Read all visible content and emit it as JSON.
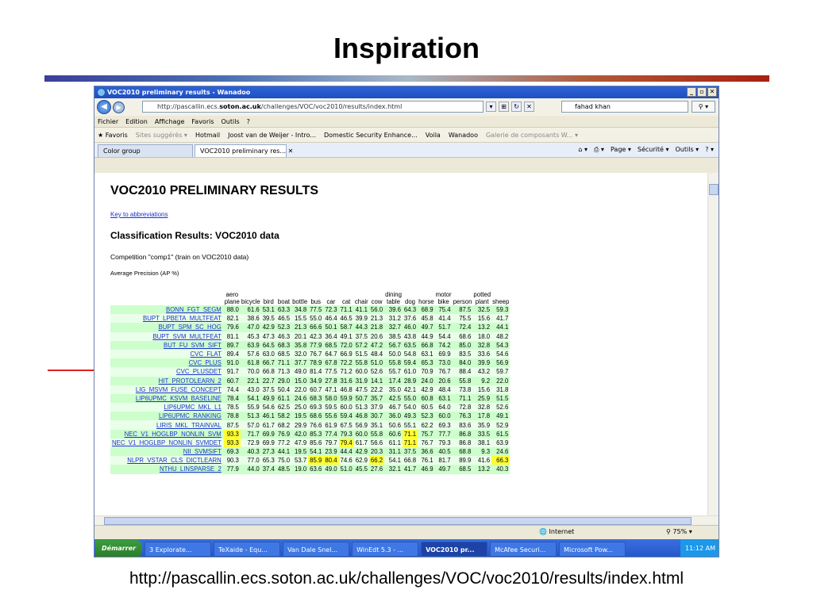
{
  "slide": {
    "title": "Inspiration",
    "caption": "http://pascallin.ecs.soton.ac.uk/challenges/VOC/voc2010/results/index.html"
  },
  "browser": {
    "window_title": "VOC2010 preliminary results - Wanadoo",
    "url_prefix": "http://pascallin.ecs.",
    "url_bold": "soton.ac.uk",
    "url_suffix": "/challenges/VOC/voc2010/results/index.html",
    "search_value": "fahad khan",
    "menu": [
      "Fichier",
      "Edition",
      "Affichage",
      "Favoris",
      "Outils",
      "?"
    ],
    "favorites": {
      "label": "Favoris",
      "items": [
        "Sites suggérés ▾",
        "Hotmail",
        "Joost van de Weijer - Intro...",
        "Domestic Security Enhance...",
        "Voila",
        "Wanadoo",
        "Galerie de composants W... ▾"
      ]
    },
    "tabs": [
      "Color group",
      "VOC2010 preliminary res..."
    ],
    "tab_tools": [
      "Page ▾",
      "Sécurité ▾",
      "Outils ▾"
    ],
    "status_zone": "Internet",
    "zoom": "75%",
    "taskbar": {
      "start": "Démarrer",
      "tasks": [
        "3 Explorate...",
        "TeXaide - Equ...",
        "Van Dale Snel...",
        "WinEdt 5.3 - ...",
        "VOC2010 pr...",
        "McAfee Securi...",
        "Microsoft Pow..."
      ],
      "clock": "11:12 AM"
    }
  },
  "page": {
    "heading": "VOC2010 PRELIMINARY RESULTS",
    "key_link": "Key to abbreviations",
    "subheading": "Classification Results: VOC2010 data",
    "competition": "Competition \"comp1\" (train on VOC2010 data)",
    "metric": "Average Precision (AP %)",
    "columns": [
      [
        "aero",
        "plane"
      ],
      [
        "",
        "bicycle"
      ],
      [
        "",
        "bird"
      ],
      [
        "",
        "boat"
      ],
      [
        "",
        "bottle"
      ],
      [
        "",
        "bus"
      ],
      [
        "",
        "car"
      ],
      [
        "",
        "cat"
      ],
      [
        "",
        "chair"
      ],
      [
        "",
        "cow"
      ],
      [
        "dining",
        "table"
      ],
      [
        "",
        "dog"
      ],
      [
        "",
        "horse"
      ],
      [
        "motor",
        "bike"
      ],
      [
        "",
        "person"
      ],
      [
        "potted",
        "plant"
      ],
      [
        "",
        "sheep"
      ]
    ],
    "rows": [
      {
        "method": "BONN_FGT_SEGM",
        "values": [
          "88.0",
          "61.6",
          "53.1",
          "63.3",
          "34.8",
          "77.5",
          "72.3",
          "71.1",
          "41.1",
          "56.0",
          "39.6",
          "64.3",
          "68.9",
          "75.4",
          "87.5",
          "32.5",
          "59.3"
        ],
        "hl": []
      },
      {
        "method": "BUPT_LPBETA_MULTFEAT",
        "values": [
          "82.1",
          "38.6",
          "39.5",
          "46.5",
          "15.5",
          "55.0",
          "46.4",
          "46.5",
          "39.9",
          "21.3",
          "31.2",
          "37.6",
          "45.8",
          "41.4",
          "75.5",
          "15.6",
          "41.7"
        ],
        "hl": []
      },
      {
        "method": "BUPT_SPM_SC_HOG",
        "values": [
          "79.6",
          "47.0",
          "42.9",
          "52.3",
          "21.3",
          "66.6",
          "50.1",
          "58.7",
          "44.3",
          "21.8",
          "32.7",
          "46.0",
          "49.7",
          "51.7",
          "72.4",
          "13.2",
          "44.1"
        ],
        "hl": []
      },
      {
        "method": "BUPT_SVM_MULTFEAT",
        "values": [
          "81.1",
          "45.3",
          "47.3",
          "46.3",
          "20.1",
          "42.3",
          "36.4",
          "49.1",
          "37.5",
          "20.6",
          "38.5",
          "43.8",
          "44.9",
          "54.4",
          "68.6",
          "18.0",
          "48.2"
        ],
        "hl": []
      },
      {
        "method": "BUT_FU_SVM_SIFT",
        "values": [
          "89.7",
          "63.9",
          "64.5",
          "68.3",
          "35.8",
          "77.9",
          "68.5",
          "72.0",
          "57.2",
          "47.2",
          "56.7",
          "63.5",
          "66.8",
          "74.2",
          "85.0",
          "32.8",
          "54.3"
        ],
        "hl": []
      },
      {
        "method": "CVC_FLAT",
        "values": [
          "89.4",
          "57.6",
          "63.0",
          "68.5",
          "32.0",
          "76.7",
          "64.7",
          "66.9",
          "51.5",
          "48.4",
          "50.0",
          "54.8",
          "63.1",
          "69.9",
          "83.5",
          "33.6",
          "54.6"
        ],
        "hl": []
      },
      {
        "method": "CVC_PLUS",
        "values": [
          "91.0",
          "61.8",
          "66.7",
          "71.1",
          "37.7",
          "78.9",
          "67.8",
          "72.2",
          "55.8",
          "51.0",
          "55.8",
          "59.4",
          "65.3",
          "73.0",
          "84.0",
          "39.9",
          "56.9"
        ],
        "hl": []
      },
      {
        "method": "CVC_PLUSDET",
        "values": [
          "91.7",
          "70.0",
          "66.8",
          "71.3",
          "49.0",
          "81.4",
          "77.5",
          "71.2",
          "60.0",
          "52.6",
          "55.7",
          "61.0",
          "70.9",
          "76.7",
          "88.4",
          "43.2",
          "59.7"
        ],
        "hl": []
      },
      {
        "method": "HIT_PROTOLEARN_2",
        "values": [
          "60.7",
          "22.1",
          "22.7",
          "29.0",
          "15.0",
          "34.9",
          "27.8",
          "31.6",
          "31.9",
          "14.1",
          "17.4",
          "28.9",
          "24.0",
          "20.6",
          "55.8",
          "9.2",
          "22.0"
        ],
        "hl": []
      },
      {
        "method": "LIG_MSVM_FUSE_CONCEPT",
        "values": [
          "74.4",
          "43.0",
          "37.5",
          "50.4",
          "22.0",
          "60.7",
          "47.1",
          "46.8",
          "47.5",
          "22.2",
          "35.0",
          "42.1",
          "42.9",
          "48.4",
          "73.8",
          "15.6",
          "31.8"
        ],
        "hl": []
      },
      {
        "method": "LIP6UPMC_KSVM_BASELINE",
        "values": [
          "78.4",
          "54.1",
          "49.9",
          "61.1",
          "24.6",
          "68.3",
          "58.0",
          "59.9",
          "50.7",
          "35.7",
          "42.5",
          "55.0",
          "60.8",
          "63.1",
          "71.1",
          "25.9",
          "51.5"
        ],
        "hl": []
      },
      {
        "method": "LIP6UPMC_MKL_L1",
        "values": [
          "78.5",
          "55.9",
          "54.6",
          "62.5",
          "25.0",
          "69.3",
          "59.5",
          "60.0",
          "51.3",
          "37.9",
          "46.7",
          "54.0",
          "60.5",
          "64.0",
          "72.8",
          "32.8",
          "52.6"
        ],
        "hl": []
      },
      {
        "method": "LIP6UPMC_RANKING",
        "values": [
          "78.8",
          "51.3",
          "46.1",
          "58.2",
          "19.5",
          "68.6",
          "55.6",
          "59.4",
          "46.8",
          "30.7",
          "36.0",
          "49.3",
          "52.3",
          "60.0",
          "76.3",
          "17.8",
          "49.1"
        ],
        "hl": []
      },
      {
        "method": "LIRIS_MKL_TRAINVAL",
        "values": [
          "87.5",
          "57.0",
          "61.7",
          "68.2",
          "29.9",
          "76.6",
          "61.9",
          "67.5",
          "56.9",
          "35.1",
          "50.6",
          "55.1",
          "62.2",
          "69.3",
          "83.6",
          "35.9",
          "52.9"
        ],
        "hl": []
      },
      {
        "method": "NEC_V1_HOGLBP_NONLIN_SVM",
        "values": [
          "93.3",
          "71.7",
          "69.9",
          "76.9",
          "42.0",
          "85.3",
          "77.4",
          "79.3",
          "60.0",
          "55.8",
          "60.6",
          "71.1",
          "75.7",
          "77.7",
          "86.8",
          "33.5",
          "61.5"
        ],
        "hl": [
          0,
          11
        ]
      },
      {
        "method": "NEC_V1_HOGLBP_NONLIN_SVMDET",
        "values": [
          "93.3",
          "72.9",
          "69.9",
          "77.2",
          "47.9",
          "85.6",
          "79.7",
          "79.4",
          "61.7",
          "56.6",
          "61.1",
          "71.1",
          "76.7",
          "79.3",
          "86.8",
          "38.1",
          "63.9"
        ],
        "hl": [
          0,
          7,
          11
        ]
      },
      {
        "method": "NII_SVMSIFT",
        "values": [
          "69.3",
          "40.3",
          "27.3",
          "44.1",
          "19.5",
          "54.1",
          "23.9",
          "44.4",
          "42.9",
          "20.3",
          "31.1",
          "37.5",
          "36.6",
          "40.5",
          "68.8",
          "9.3",
          "24.6"
        ],
        "hl": []
      },
      {
        "method": "NLPR_VSTAR_CLS_DICTLEARN",
        "values": [
          "90.3",
          "77.0",
          "65.3",
          "75.0",
          "53.7",
          "85.9",
          "80.4",
          "74.6",
          "62.9",
          "66.2",
          "54.1",
          "66.8",
          "76.1",
          "81.7",
          "89.9",
          "41.6",
          "66.3"
        ],
        "hl": [
          5,
          6,
          9,
          16
        ]
      },
      {
        "method": "NTHU_LINSPARSE_2",
        "values": [
          "77.9",
          "44.0",
          "37.4",
          "48.5",
          "19.0",
          "63.6",
          "49.0",
          "51.0",
          "45.5",
          "27.6",
          "32.1",
          "41.7",
          "46.9",
          "49.7",
          "68.5",
          "13.2",
          "40.3"
        ],
        "hl": []
      }
    ]
  }
}
